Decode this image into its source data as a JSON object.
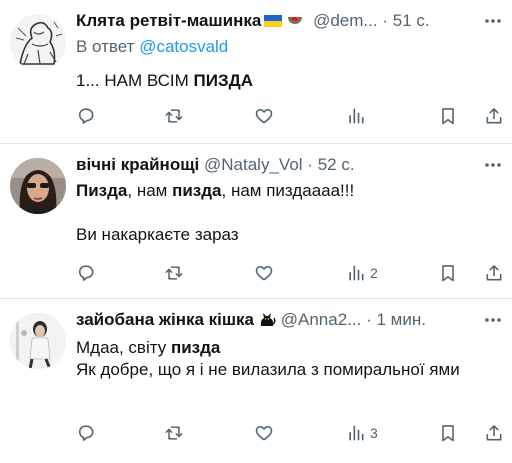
{
  "tweets": [
    {
      "name": "Клята ретвіт-машинка",
      "handle": "@dem...",
      "time": "51 с.",
      "reply_prefix": "В ответ",
      "reply_handle": "@catosvald",
      "text_parts": [
        {
          "t": "1... НАМ ВСІМ ",
          "b": false
        },
        {
          "t": "ПИЗДА",
          "b": true
        }
      ],
      "views": ""
    },
    {
      "name": "вічні крайнощі",
      "handle": "@Nataly_Vol",
      "time": "52 с.",
      "text_parts": [
        {
          "t": "Пизда",
          "b": true
        },
        {
          "t": ", нам ",
          "b": false
        },
        {
          "t": "пизда",
          "b": true
        },
        {
          "t": ", нам пиздаааа!!!\n\nВи накаркаєте зараз",
          "b": false
        }
      ],
      "views": "2"
    },
    {
      "name": "зайобана жінка кішка",
      "handle": "@Anna2...",
      "time": "1 мин.",
      "text_parts": [
        {
          "t": "Мдаа, світу ",
          "b": false
        },
        {
          "t": "пизда",
          "b": true
        },
        {
          "t": "\nЯк добре, що я і не вилазила з помиральної ями",
          "b": false
        }
      ],
      "views": "3"
    }
  ],
  "separator": "·",
  "icons": [
    "reply-icon",
    "retweet-icon",
    "like-icon",
    "views-icon",
    "bookmark-icon",
    "share-icon",
    "more-icon"
  ],
  "colors": {
    "text": "#0f1419",
    "secondary": "#536471",
    "link": "#1d9bf0",
    "divider": "#e6e9ec"
  }
}
